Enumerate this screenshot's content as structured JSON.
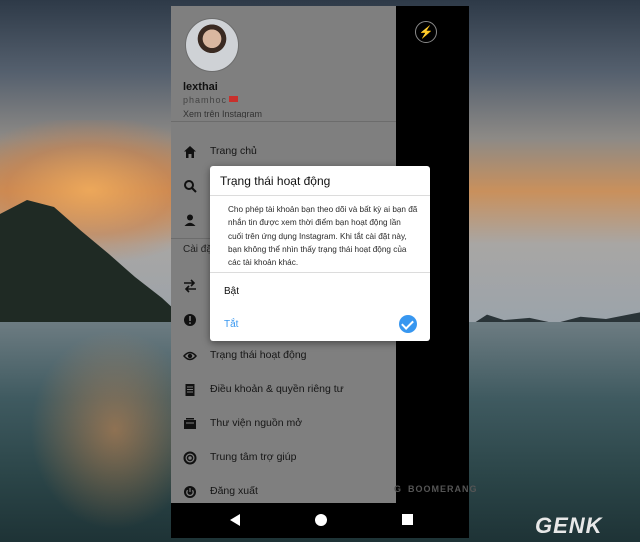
{
  "drawer": {
    "username": "lexthai",
    "subname": "phamhoc",
    "view_on_instagram": "Xem trên Instagram",
    "top_items": [
      {
        "label": "Trang chủ",
        "icon": "home-icon"
      },
      {
        "label": "",
        "icon": "search-icon"
      },
      {
        "label": "",
        "icon": "profile-icon"
      }
    ],
    "settings_label": "Cài đặt",
    "bottom_items": [
      {
        "label": "",
        "icon": "switch-icon"
      },
      {
        "label": "",
        "icon": "info-icon"
      },
      {
        "label": "Trạng thái hoạt động",
        "icon": "eye-icon"
      },
      {
        "label": "Điều khoản & quyền riêng tư",
        "icon": "document-icon"
      },
      {
        "label": "Thư viện nguồn mở",
        "icon": "library-icon"
      },
      {
        "label": "Trung tâm trợ giúp",
        "icon": "lifebuoy-icon"
      },
      {
        "label": "Đăng xuất",
        "icon": "power-icon"
      }
    ]
  },
  "camera": {
    "boomerang_label": "BOOMERANG",
    "g_label": "G"
  },
  "dialog": {
    "title": "Trạng thái hoạt động",
    "body": "Cho phép tài khoản bạn theo dõi và bất kỳ ai bạn đã nhắn tin được xem thời điểm bạn hoạt động lần cuối trên ứng dụng Instagram. Khi tắt cài đặt này, bạn không thể nhìn thấy trạng thái hoạt động của các tài khoản khác.",
    "option_on": "Bật",
    "option_off": "Tắt",
    "selected": "Tắt",
    "accent_color": "#3897f0"
  },
  "watermark": {
    "text": "GENK"
  }
}
